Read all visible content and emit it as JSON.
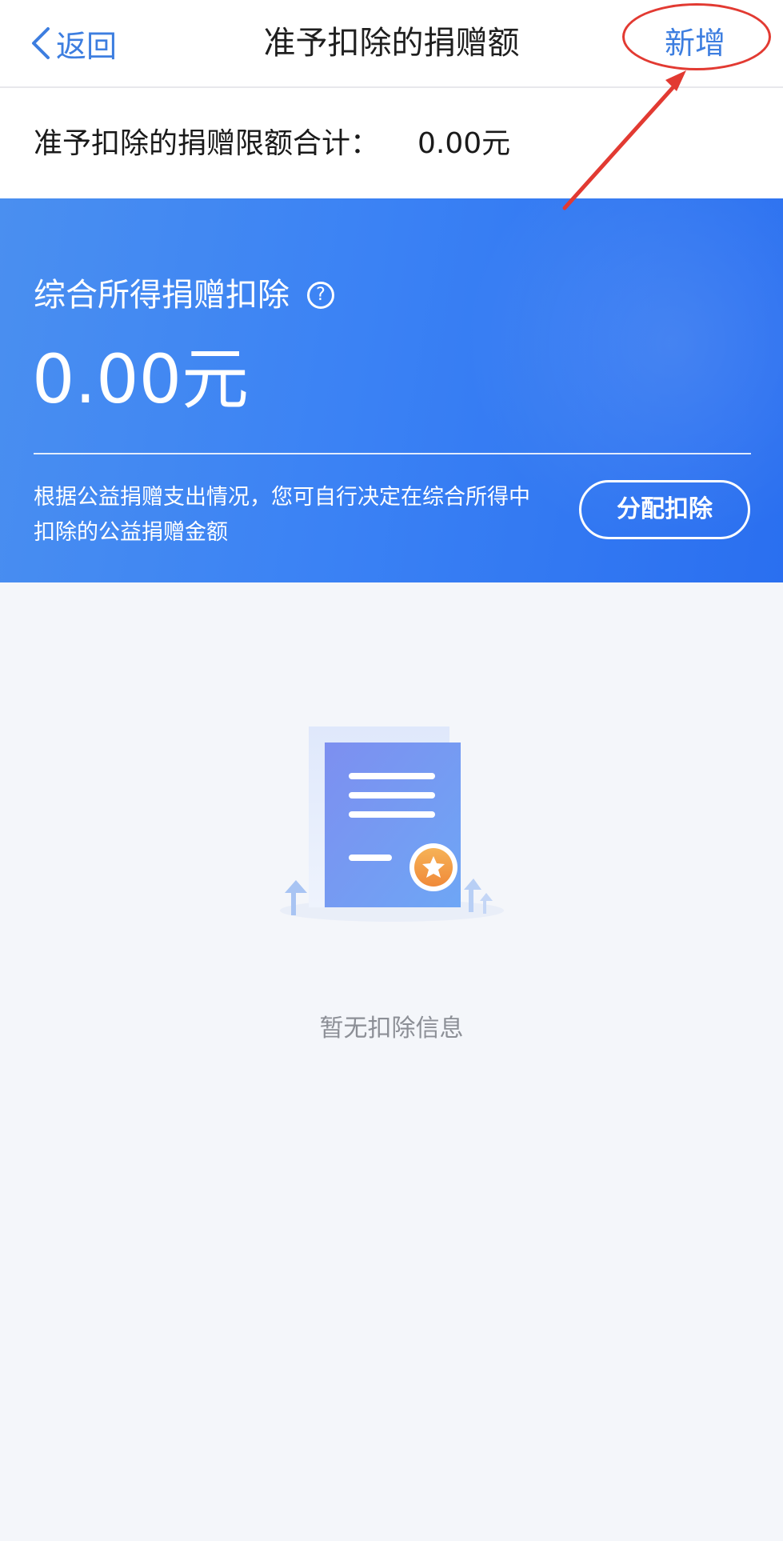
{
  "nav": {
    "back_label": "返回",
    "title": "准予扣除的捐赠额",
    "add_label": "新增"
  },
  "limit": {
    "label": "准予扣除的捐赠限额合计：",
    "value": "0.00元"
  },
  "card": {
    "title": "综合所得捐赠扣除",
    "help_icon": "?",
    "amount": "0.00元",
    "description": "根据公益捐赠支出情况，您可自行决定在综合所得中扣除的公益捐赠金额",
    "allocate_label": "分配扣除"
  },
  "empty": {
    "text": "暂无扣除信息"
  },
  "colors": {
    "accent": "#3d7ee0",
    "card_blue": "#3b82f4",
    "annotation_red": "#e23a32",
    "badge_orange": "#f2a24a"
  },
  "icons": {
    "back": "chevron-left-icon",
    "help": "question-circle-icon",
    "empty": "certificate-star-icon"
  }
}
